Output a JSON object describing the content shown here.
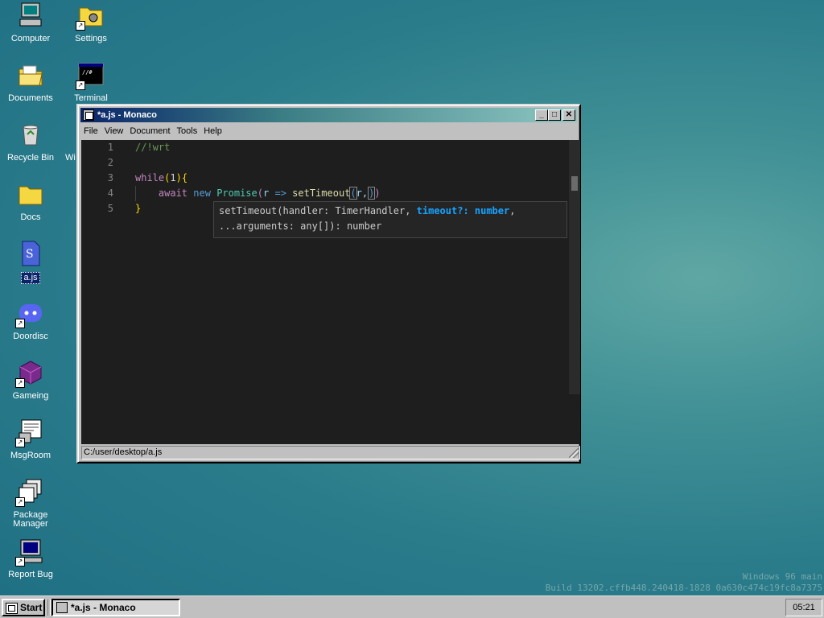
{
  "desktop": {
    "icons": [
      {
        "label": "Computer"
      },
      {
        "label": "Settings"
      },
      {
        "label": "Documents"
      },
      {
        "label": "Terminal"
      },
      {
        "label": "Recycle Bin"
      },
      {
        "label": "Wi"
      },
      {
        "label": "Docs"
      },
      {
        "label": "a.js"
      },
      {
        "label": "Doordisc"
      },
      {
        "label": "Gameing"
      },
      {
        "label": "MsgRoom"
      },
      {
        "label": "Package Manager"
      },
      {
        "label": "Report Bug"
      }
    ]
  },
  "window": {
    "title": "*a.js - Monaco",
    "menu": [
      "File",
      "View",
      "Document",
      "Tools",
      "Help"
    ],
    "line_numbers": [
      "1",
      "2",
      "3",
      "4",
      "5"
    ],
    "code": {
      "line1": "//!wrt",
      "line3_kw": "while",
      "line3_num": "1",
      "line4_await": "await",
      "line4_new": "new",
      "line4_class": "Promise",
      "line4_param": "r",
      "line4_arrow": "=>",
      "line4_fn": "setTimeout",
      "line4_arg": "r,"
    },
    "hint": {
      "line1_pre": "setTimeout(handler: TimerHandler, ",
      "line1_active": "timeout?: number",
      "line1_post": ",",
      "line2": "...arguments: any[]): number"
    },
    "status_path": "C:/user/desktop/a.js"
  },
  "taskbar": {
    "start_label": "Start",
    "task_label": "*a.js - Monaco",
    "clock": "05:21"
  },
  "watermark": {
    "line1": "Windows 96 main",
    "line2": "Build 13202.cffb448.240418-1828 0a630c474c19fc8a7375"
  },
  "colors": {
    "title_gradient_start": "#0a246a",
    "hint_active": "#18a3ff",
    "editor_bg": "#1e1e1e"
  }
}
